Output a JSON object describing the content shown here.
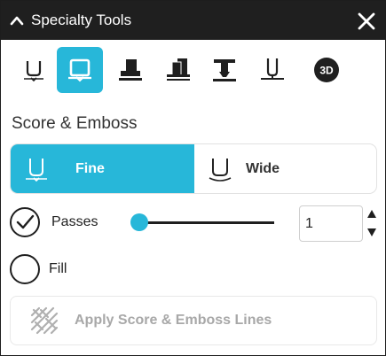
{
  "window": {
    "title": "Specialty Tools",
    "collapse_icon": "chevron-up-icon",
    "close_icon": "close-icon"
  },
  "tools": [
    {
      "name": "score-emboss-tool-icon",
      "active": false
    },
    {
      "name": "deboss-tool-icon",
      "active": true
    },
    {
      "name": "engrave-tool-icon",
      "active": false
    },
    {
      "name": "multi-layer-tool-icon",
      "active": false
    },
    {
      "name": "stamp-tool-icon",
      "active": false
    },
    {
      "name": "pen-plate-tool-icon",
      "active": false
    },
    {
      "name": "3d-tool-icon",
      "active": false,
      "label": "3D"
    }
  ],
  "section": {
    "title": "Score & Emboss"
  },
  "mode": {
    "options": [
      {
        "label": "Fine",
        "selected": true
      },
      {
        "label": "Wide",
        "selected": false
      }
    ]
  },
  "passes": {
    "label": "Passes",
    "checked": true,
    "value": "1"
  },
  "fill": {
    "label": "Fill",
    "checked": false
  },
  "apply": {
    "label": "Apply Score & Emboss Lines",
    "enabled": false
  },
  "colors": {
    "accent": "#27b7d9",
    "titlebar": "#1f1f1f",
    "disabled_text": "#a8a8a8"
  }
}
